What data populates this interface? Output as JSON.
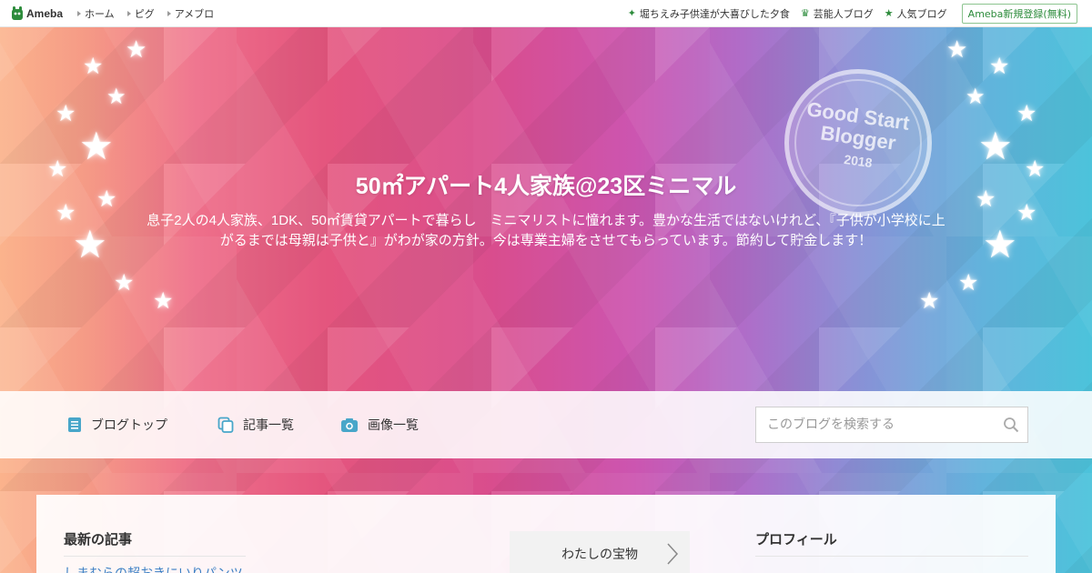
{
  "topbar": {
    "logo": "Ameba",
    "nav": [
      "ホーム",
      "ピグ",
      "アメブロ"
    ],
    "right_links": [
      {
        "icon": "sparkle-icon",
        "label": "堀ちえみ子供達が大喜びした夕食"
      },
      {
        "icon": "crown-icon",
        "label": "芸能人ブログ"
      },
      {
        "icon": "star-icon",
        "label": "人気ブログ"
      }
    ],
    "signup": "Ameba新規登録(無料)"
  },
  "header": {
    "title": "50㎡アパート4人家族@23区ミニマル",
    "description": "息子2人の4人家族、1DK、50㎡賃貸アパートで暮らし　ミニマリストに憧れます。豊かな生活ではないけれど、『子供が小学校に上がるまでは母親は子供と』がわが家の方針。今は専業主婦をさせてもらっています。節約して貯金します！",
    "badge": {
      "line1": "Good Start",
      "line2": "Blogger",
      "year": "2018"
    }
  },
  "nav": {
    "items": [
      {
        "label": "ブログトップ",
        "icon": "document-icon"
      },
      {
        "label": "記事一覧",
        "icon": "copy-icon"
      },
      {
        "label": "画像一覧",
        "icon": "camera-icon"
      }
    ],
    "search_placeholder": "このブログを検索する"
  },
  "content": {
    "latest_title": "最新の記事",
    "latest_first": "しまむらの超おきにいりパンツ",
    "treasure": "わたしの宝物",
    "profile_title": "プロフィール"
  },
  "colors": {
    "brand_green": "#2d8c3c",
    "link_blue": "#3b7fc4",
    "nav_icon": "#48a6c9"
  }
}
